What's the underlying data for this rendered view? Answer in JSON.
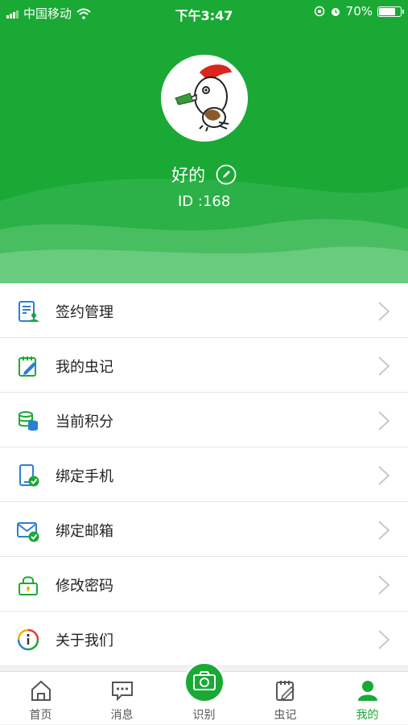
{
  "status_bar": {
    "carrier": "中国移动",
    "time": "下午3:47",
    "battery": "70%",
    "battery_level": 0.7
  },
  "profile": {
    "username": "好的",
    "user_id": "ID :168"
  },
  "menu": [
    {
      "label": "签约管理",
      "icon": "contract-icon"
    },
    {
      "label": "我的虫记",
      "icon": "notebook-icon"
    },
    {
      "label": "当前积分",
      "icon": "coins-icon"
    },
    {
      "label": "绑定手机",
      "icon": "phone-check-icon"
    },
    {
      "label": "绑定邮箱",
      "icon": "mail-check-icon"
    },
    {
      "label": "修改密码",
      "icon": "lock-icon"
    },
    {
      "label": "关于我们",
      "icon": "info-icon"
    }
  ],
  "tabs": [
    {
      "label": "首页",
      "icon": "home-icon",
      "active": false
    },
    {
      "label": "消息",
      "icon": "message-icon",
      "active": false
    },
    {
      "label": "识别",
      "icon": "camera-icon",
      "active": false
    },
    {
      "label": "虫记",
      "icon": "note-edit-icon",
      "active": false
    },
    {
      "label": "我的",
      "icon": "person-icon",
      "active": true
    }
  ],
  "colors": {
    "brand_green": "#1aa935",
    "icon_blue": "#2a7fd6"
  }
}
